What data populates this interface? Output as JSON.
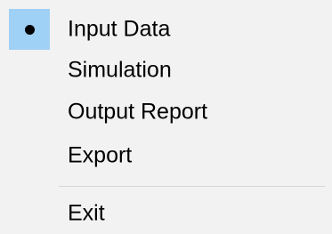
{
  "menu": {
    "items": [
      {
        "label": "Input Data",
        "checked": true
      },
      {
        "label": "Simulation",
        "checked": false
      },
      {
        "label": "Output Report",
        "checked": false
      },
      {
        "label": "Export",
        "checked": false
      }
    ],
    "exit_label": "Exit",
    "check_icon": "bullet-icon",
    "colors": {
      "background": "#f2f2f2",
      "checked_highlight": "#9fd0f5",
      "separator": "#d7d7d7",
      "text": "#000000"
    }
  }
}
